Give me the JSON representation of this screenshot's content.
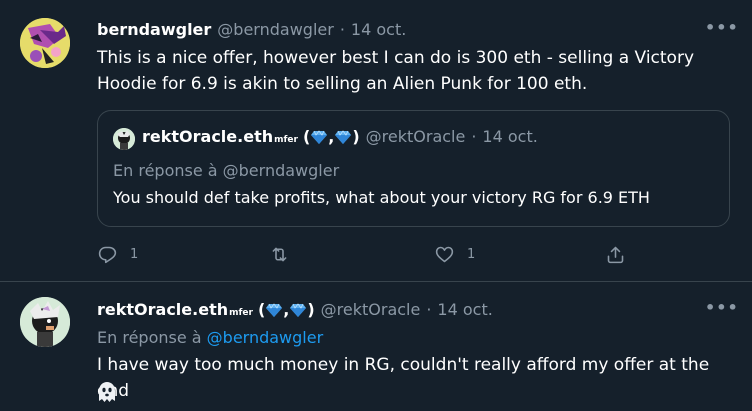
{
  "tweet1": {
    "name": "berndawgler",
    "handle": "@berndawgler",
    "separator": "·",
    "date": "14 oct.",
    "more": "•••",
    "text": "This is a nice offer, however best I can do is 300 eth - selling a Victory Hoodie for 6.9 is akin to selling an Alien Punk for 100 eth.",
    "quote": {
      "name": "rektOracle.eth",
      "name_sup": "mfer",
      "name_paren_open": "(",
      "name_paren_sep": ",",
      "name_paren_close": ")",
      "handle": "@rektOracle",
      "separator": "·",
      "date": "14 oct.",
      "reply_to": "En réponse à @berndawgler",
      "text": "You should def take profits, what about your victory RG for 6.9 ETH"
    },
    "actions": {
      "reply_count": "1",
      "retweet_count": "",
      "like_count": "1"
    }
  },
  "tweet2": {
    "name": "rektOracle.eth",
    "name_sup": "mfer",
    "name_paren_open": "(",
    "name_paren_sep": ",",
    "name_paren_close": ")",
    "handle": "@rektOracle",
    "separator": "·",
    "date": "14 oct.",
    "more": "•••",
    "reply_prefix": "En réponse à",
    "reply_mention": "@berndawgler",
    "text": "I have way too much money in RG, couldn't really afford my offer at the end"
  },
  "icons": {
    "gem": "gem-emoji",
    "ghost": "ghost-emoji",
    "reply": "reply-icon",
    "retweet": "retweet-icon",
    "like": "heart-icon",
    "share": "share-icon"
  },
  "colors": {
    "background": "#15202b",
    "muted": "#8b98a5",
    "link": "#1d9bf0",
    "border": "#38444d"
  }
}
